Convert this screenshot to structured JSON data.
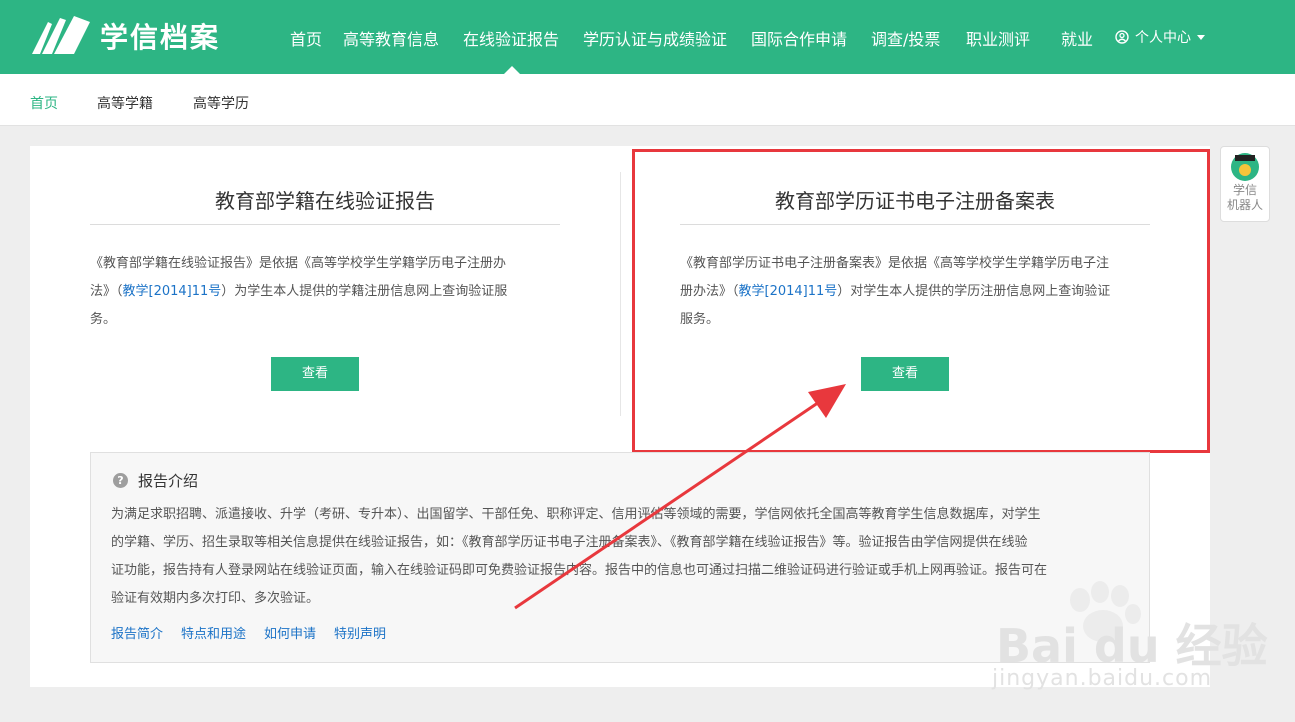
{
  "header": {
    "brand": "学信档案",
    "nav": [
      {
        "label": "首页",
        "active": false
      },
      {
        "label": "高等教育信息",
        "active": false
      },
      {
        "label": "在线验证报告",
        "active": true
      },
      {
        "label": "学历认证与成绩验证",
        "active": false
      },
      {
        "label": "国际合作申请",
        "active": false
      },
      {
        "label": "调查/投票",
        "active": false
      },
      {
        "label": "职业测评",
        "active": false
      },
      {
        "label": "就业",
        "active": false
      }
    ],
    "user_menu": "个人中心",
    "brand_color": "#2db584"
  },
  "breadcrumb": {
    "items": [
      "首页",
      "高等学籍",
      "高等学历"
    ]
  },
  "cards": [
    {
      "title": "教育部学籍在线验证报告",
      "desc_line1": "《教育部学籍在线验证报告》是依据《高等学校学生学籍学历电子注册办",
      "desc_line2_pre": "法》（",
      "desc_link": "教学[2014]11号",
      "desc_line2_post": "）为学生本人提供的学籍注册信息网上查询验证服",
      "desc_line3": "务。",
      "button": "查看"
    },
    {
      "title": "教育部学历证书电子注册备案表",
      "desc_line1": "《教育部学历证书电子注册备案表》是依据《高等学校学生学籍学历电子注",
      "desc_line2_pre": "册办法》（",
      "desc_link": "教学[2014]11号",
      "desc_line2_post": "）对学生本人提供的学历注册信息网上查询验证",
      "desc_line3": "服务。",
      "button": "查看"
    }
  ],
  "intro": {
    "title": "报告介绍",
    "lines": [
      "为满足求职招聘、派遣接收、升学（考研、专升本）、出国留学、干部任免、职称评定、信用评估等领域的需要，学信网依托全国高等教育学生信息数据库，对学生",
      "的学籍、学历、招生录取等相关信息提供在线验证报告，如：《教育部学历证书电子注册备案表》、《教育部学籍在线验证报告》等。验证报告由学信网提供在线验",
      "证功能，报告持有人登录网站在线验证页面，输入在线验证码即可免费验证报告内容。报告中的信息也可通过扫描二维验证码进行验证或手机上网再验证。报告可在",
      "验证有效期内多次打印、多次验证。"
    ],
    "links": [
      "报告简介",
      "特点和用途",
      "如何申请",
      "特别声明"
    ]
  },
  "robot": {
    "line1": "学信",
    "line2": "机器人"
  },
  "watermark": {
    "brand": "Bai du 经验",
    "url": "jingyan.baidu.com"
  },
  "annotation_color": "#e8383d"
}
